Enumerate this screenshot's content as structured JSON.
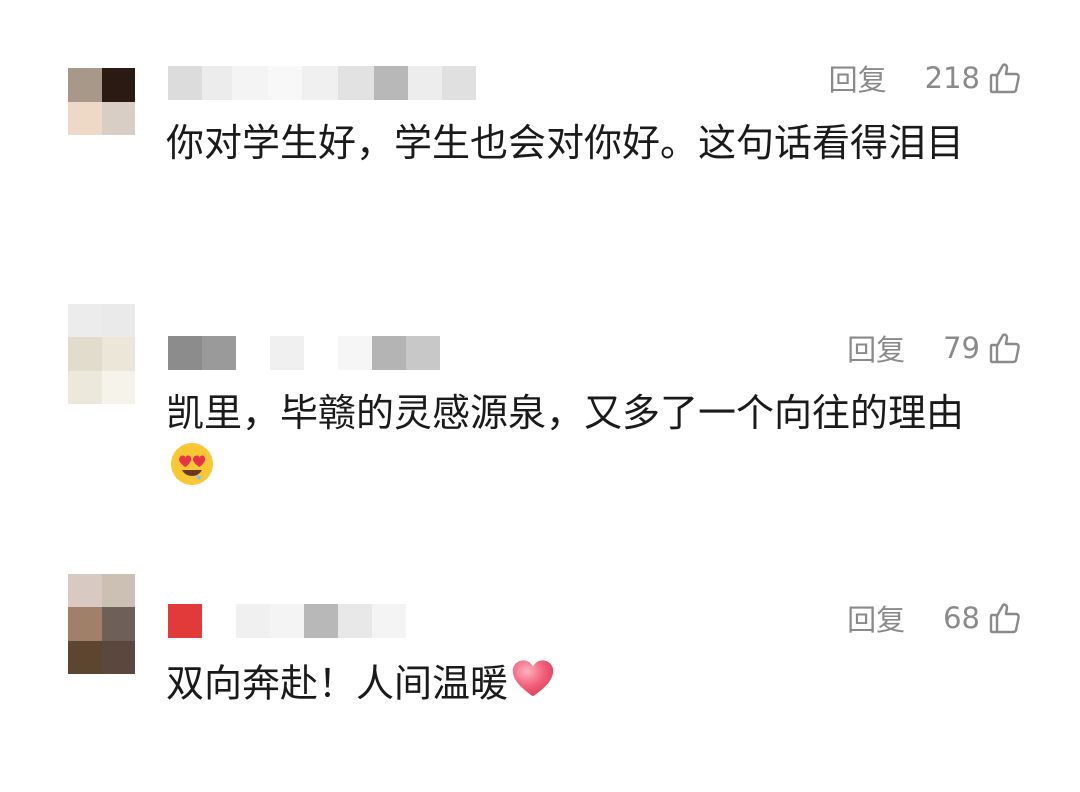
{
  "comments": [
    {
      "reply_label": "回复",
      "likes": "218",
      "text": "你对学生好，学生也会对你好。这句话看得泪目"
    },
    {
      "reply_label": "回复",
      "likes": "79",
      "text": "凯里，毕赣的灵感源泉，又多了一个向往的理由",
      "emoji": "heart-eyes-drooling-face-icon"
    },
    {
      "reply_label": "回复",
      "likes": "68",
      "text": "双向奔赴！人间温暖",
      "emoji": "heart-icon"
    }
  ],
  "colors": {
    "text": "#1a1a1a",
    "meta": "#8a8a8a",
    "heart": "#f2607a"
  }
}
